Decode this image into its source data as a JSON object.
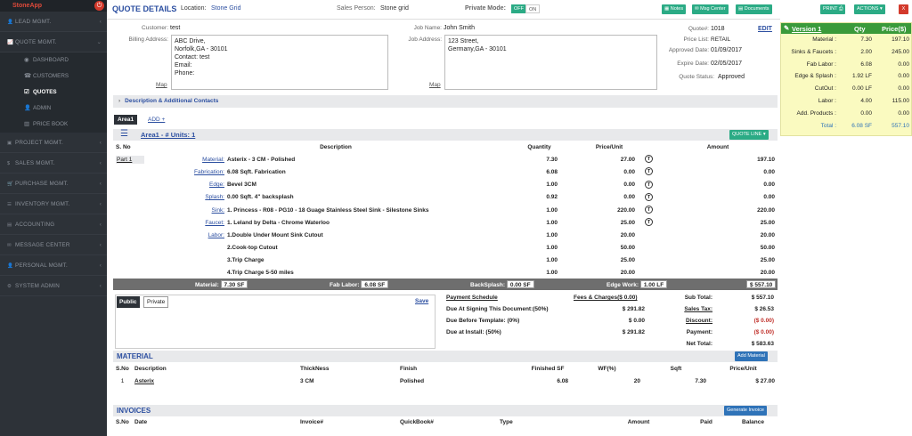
{
  "app": {
    "logo": "StoneApp"
  },
  "sidebar": {
    "items": [
      {
        "label": "LEAD MGMT.",
        "icon": "user-plus-icon"
      },
      {
        "label": "QUOTE MGMT.",
        "icon": "chart-line-icon",
        "expanded": true
      },
      {
        "label": "PROJECT MGMT.",
        "icon": "folder-icon"
      },
      {
        "label": "SALES MGMT.",
        "icon": "dollar-icon"
      },
      {
        "label": "PURCHASE MGMT.",
        "icon": "cart-icon"
      },
      {
        "label": "INVENTORY MGMT.",
        "icon": "list-icon"
      },
      {
        "label": "ACCOUNTING",
        "icon": "file-icon"
      },
      {
        "label": "MESSAGE CENTER",
        "icon": "envelope-icon"
      },
      {
        "label": "PERSONAL MGMT.",
        "icon": "user-icon"
      },
      {
        "label": "SYSTEM ADMIN",
        "icon": "gear-icon"
      }
    ],
    "subitems": [
      {
        "label": "DASHBOARD",
        "icon": "dashboard-icon"
      },
      {
        "label": "CUSTOMERS",
        "icon": "phone-icon"
      },
      {
        "label": "QUOTES",
        "icon": "check-square-icon",
        "active": true
      },
      {
        "label": "ADMIN",
        "icon": "user-icon"
      },
      {
        "label": "PRICE BOOK",
        "icon": "book-icon"
      }
    ]
  },
  "header": {
    "title": "QUOTE DETAILS",
    "location_label": "Location:",
    "location": "Stone Grid",
    "sales_label": "Sales Person:",
    "sales_person": "Stone grid",
    "private_label": "Private Mode:",
    "off": "OFF",
    "on": "ON",
    "notes": "Notes",
    "msg": "Msg Center",
    "docs": "Documents",
    "print": "PRINT",
    "actions": "ACTIONS",
    "close": "X"
  },
  "customer": {
    "label": "Customer:",
    "name": "test",
    "billing_label": "Billing Address:",
    "billing": [
      "ABC Drive,",
      "Norfolk,GA - 30101",
      "Contact: test",
      "Email:",
      "Phone:"
    ],
    "map": "Map"
  },
  "job": {
    "label": "Job Name:",
    "name": "John Smith",
    "addr_label": "Job Address:",
    "address": [
      "123 Street,",
      "Germany,GA - 30101"
    ],
    "map": "Map"
  },
  "quote": {
    "num_label": "Quote#:",
    "num": "1018",
    "edit": "EDIT",
    "pl_label": "Price List:",
    "price_list": "RETAIL",
    "ad_label": "Approved Date:",
    "approved": "01/09/2017",
    "ed_label": "Expire Date:",
    "expire": "02/05/2017",
    "st_label": "Quote Status:",
    "status": "Approved"
  },
  "desc_bar": "Description & Additional Contacts",
  "area": {
    "tab": "Area1",
    "add": "ADD +",
    "title": "Area1 - # Units: 1",
    "quote_line": "QUOTE LINE"
  },
  "table": {
    "headers": [
      "S. No",
      "Description",
      "Quantity",
      "Price/Unit",
      "Amount"
    ],
    "part": "Part 1",
    "rows": [
      {
        "cat": "Material:",
        "desc": "Asterix - 3 CM - Polished",
        "qty": "7.30",
        "price": "27.00",
        "t": true,
        "amt": "197.10"
      },
      {
        "cat": "Fabrication:",
        "desc": "6.08 Sqft. Fabrication",
        "qty": "6.08",
        "price": "0.00",
        "t": true,
        "amt": "0.00"
      },
      {
        "cat": "Edge:",
        "desc": "Bevel 3CM",
        "qty": "1.00",
        "price": "0.00",
        "t": true,
        "amt": "0.00"
      },
      {
        "cat": "Splash:",
        "desc": "0.00 Sqft. 4\" backsplash",
        "qty": "0.92",
        "price": "0.00",
        "t": true,
        "amt": "0.00"
      },
      {
        "cat": "Sink:",
        "desc": "1. Princess - R08 - PG10 - 18 Guage Stainless Steel Sink - Silestone Sinks",
        "qty": "1.00",
        "price": "220.00",
        "t": true,
        "amt": "220.00"
      },
      {
        "cat": "Faucet:",
        "desc": "1. Leland by Delta - Chrome Waterloo",
        "qty": "1.00",
        "price": "25.00",
        "t": true,
        "amt": "25.00"
      },
      {
        "cat": "Labor:",
        "desc": "1.Double Under Mount Sink Cutout",
        "qty": "1.00",
        "price": "20.00",
        "t": false,
        "amt": "20.00"
      },
      {
        "cat": "",
        "desc": "2.Cook-top Cutout",
        "qty": "1.00",
        "price": "50.00",
        "t": false,
        "amt": "50.00"
      },
      {
        "cat": "",
        "desc": "3.Trip Charge",
        "qty": "1.00",
        "price": "25.00",
        "t": false,
        "amt": "25.00"
      },
      {
        "cat": "",
        "desc": "4.Trip Charge 5-50 miles",
        "qty": "1.00",
        "price": "20.00",
        "t": false,
        "amt": "20.00"
      }
    ]
  },
  "summary": {
    "material_label": "Material:",
    "material": "7.30 SF",
    "fab_label": "Fab Labor:",
    "fab": "6.08 SF",
    "bs_label": "BackSplash:",
    "bs": "0.00 SF",
    "edge_label": "Edge Work:",
    "edge": "1.00 LF",
    "total": "$ 557.10"
  },
  "notes": {
    "public": "Public",
    "private": "Private",
    "save": "Save"
  },
  "payment": {
    "title": "Payment Schedule",
    "fees": "Fees & Charges($ 0.00)",
    "rows": [
      {
        "label": "Due At Signing This Document:(50%)",
        "value": "$ 291.82"
      },
      {
        "label": "Due Before Template: (0%)",
        "value": "$ 0.00"
      },
      {
        "label": "Due at Install: (50%)",
        "value": "$ 291.82"
      }
    ]
  },
  "totals": [
    {
      "label": "Sub Total:",
      "value": "$ 557.10",
      "u": false,
      "red": false
    },
    {
      "label": "Sales Tax:",
      "value": "$ 26.53",
      "u": true,
      "red": false
    },
    {
      "label": "Discount:",
      "value": "($ 0.00)",
      "u": true,
      "red": true
    },
    {
      "label": "Payment:",
      "value": "($ 0.00)",
      "u": false,
      "red": true
    },
    {
      "label": "Net Total:",
      "value": "$ 583.63",
      "u": false,
      "red": false
    }
  ],
  "material": {
    "title": "MATERIAL",
    "add": "Add Material",
    "headers": [
      "S.No",
      "Description",
      "ThickNess",
      "Finish",
      "Finished SF",
      "WF(%)",
      "Sqft",
      "Price/Unit"
    ],
    "rows": [
      {
        "sno": "1",
        "desc": "Asterix",
        "thick": "3 CM",
        "finish": "Polished",
        "fsf": "6.08",
        "wf": "20",
        "sqft": "7.30",
        "price": "$ 27.00"
      }
    ]
  },
  "invoices": {
    "title": "INVOICES",
    "gen": "Generate Invoice",
    "headers": [
      "S.No",
      "Date",
      "Invoice#",
      "QuickBook#",
      "Type",
      "Amount",
      "Paid",
      "Balance"
    ]
  },
  "version": {
    "title": "Version 1",
    "qty": "Qty",
    "price": "Price($)",
    "rows": [
      {
        "label": "Material :",
        "qty": "7.30",
        "price": "197.10"
      },
      {
        "label": "Sinks & Faucets :",
        "qty": "2.00",
        "price": "245.00"
      },
      {
        "label": "Fab Labor :",
        "qty": "6.08",
        "price": "0.00"
      },
      {
        "label": "Edge & Splash :",
        "qty": "1.92 LF",
        "price": "0.00"
      },
      {
        "label": "CutOut :",
        "qty": "0.00 LF",
        "price": "0.00"
      },
      {
        "label": "Labor :",
        "qty": "4.00",
        "price": "115.00"
      },
      {
        "label": "Add. Products :",
        "qty": "0.00",
        "price": "0.00"
      },
      {
        "label": "Total :",
        "qty": "6.08 SF",
        "price": "557.10"
      }
    ]
  }
}
